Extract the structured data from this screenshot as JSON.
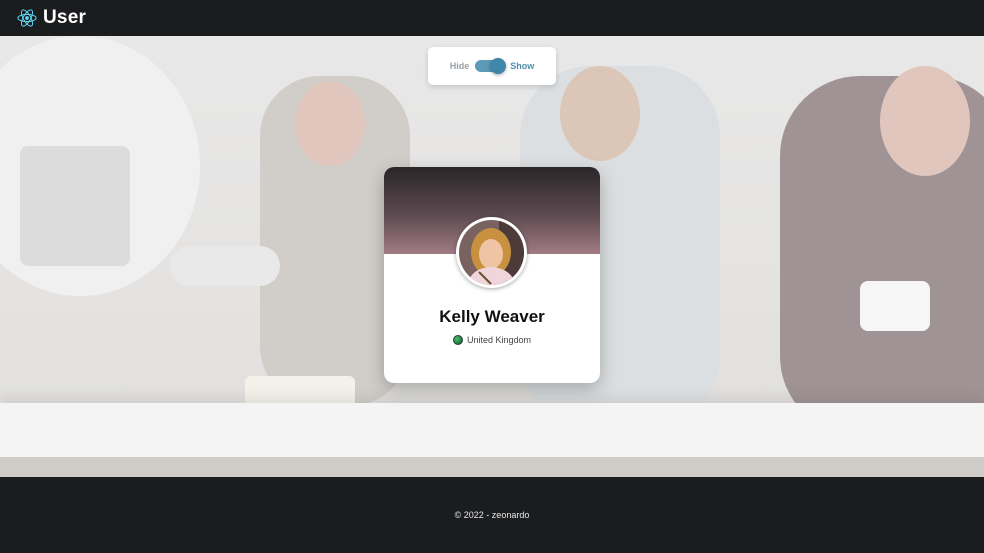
{
  "header": {
    "title": "User",
    "logo_icon": "react-atom-icon",
    "logo_color": "#61dafb"
  },
  "visibility_toggle": {
    "off_label": "Hide",
    "on_label": "Show",
    "state": "on",
    "accent": "#4f8fad"
  },
  "profile_card": {
    "name": "Kelly Weaver",
    "country": "United Kingdom",
    "country_icon": "globe-icon",
    "avatar_icon": "user-photo"
  },
  "footer": {
    "copyright": "© 2022 - zeonardo"
  }
}
